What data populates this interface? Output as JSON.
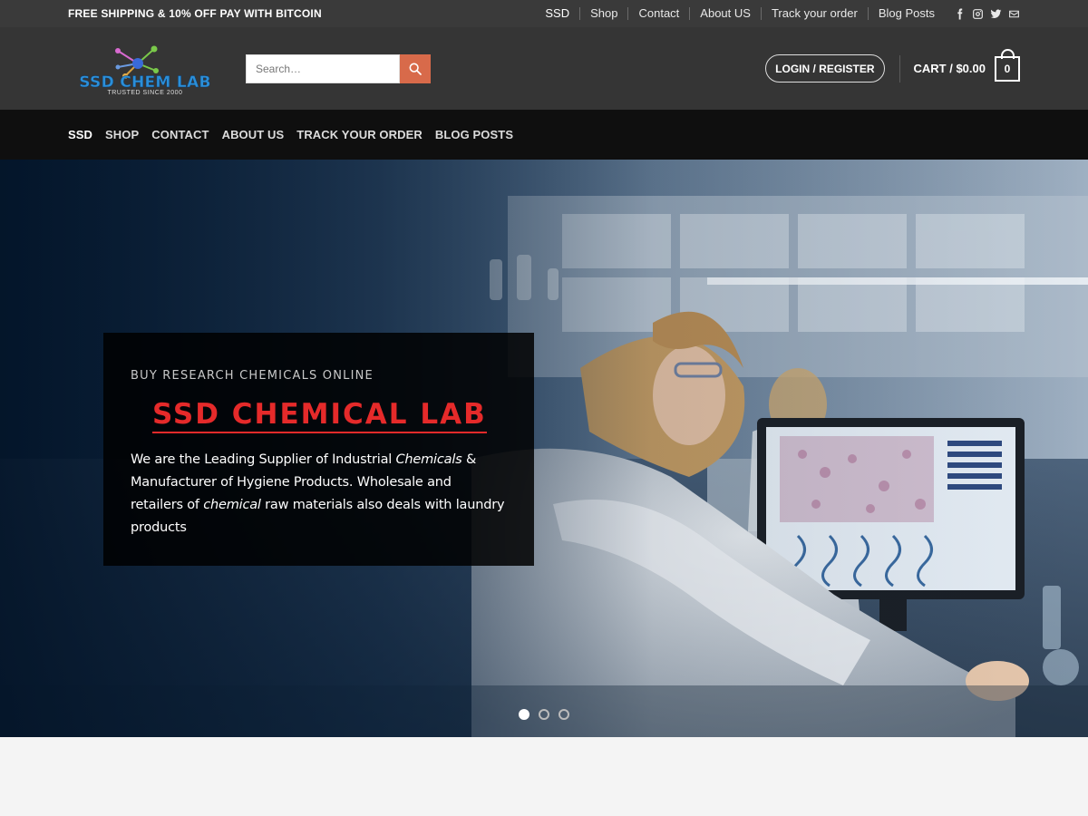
{
  "topbar": {
    "promo": "FREE SHIPPING & 10% OFF PAY WITH BITCOIN",
    "links": [
      "SSD",
      "Shop",
      "Contact",
      "About US",
      "Track your order",
      "Blog Posts"
    ],
    "social_icons": [
      "facebook-icon",
      "instagram-icon",
      "twitter-icon",
      "email-icon"
    ]
  },
  "header": {
    "logo_text": "SSD CHEM LAB",
    "logo_tagline": "TRUSTED SINCE 2000",
    "search_placeholder": "Search…",
    "login_label": "LOGIN / REGISTER",
    "cart_label": "CART / $0.00",
    "cart_count": "0"
  },
  "mainnav": {
    "items": [
      "SSD",
      "SHOP",
      "CONTACT",
      "ABOUT US",
      "TRACK YOUR ORDER",
      "BLOG POSTS"
    ],
    "active": "SSD"
  },
  "hero": {
    "kicker": "BUY RESEARCH CHEMICALS ONLINE",
    "title": "SSD CHEMICAL LAB",
    "desc_part1": "We are the Leading Supplier of Industrial ",
    "desc_em1": "Chemicals",
    "desc_part2": " & Manufacturer of Hygiene Products. Wholesale and retailers of ",
    "desc_em2": "chemical",
    "desc_part3": " raw materials also deals with laundry products",
    "slides": 3,
    "active_slide": 1
  },
  "colors": {
    "topbar_bg": "#3a3a3a",
    "header_bg": "#353535",
    "nav_bg": "#0f0f0f",
    "accent": "#d86a4a",
    "hero_title": "#e52a2a"
  }
}
